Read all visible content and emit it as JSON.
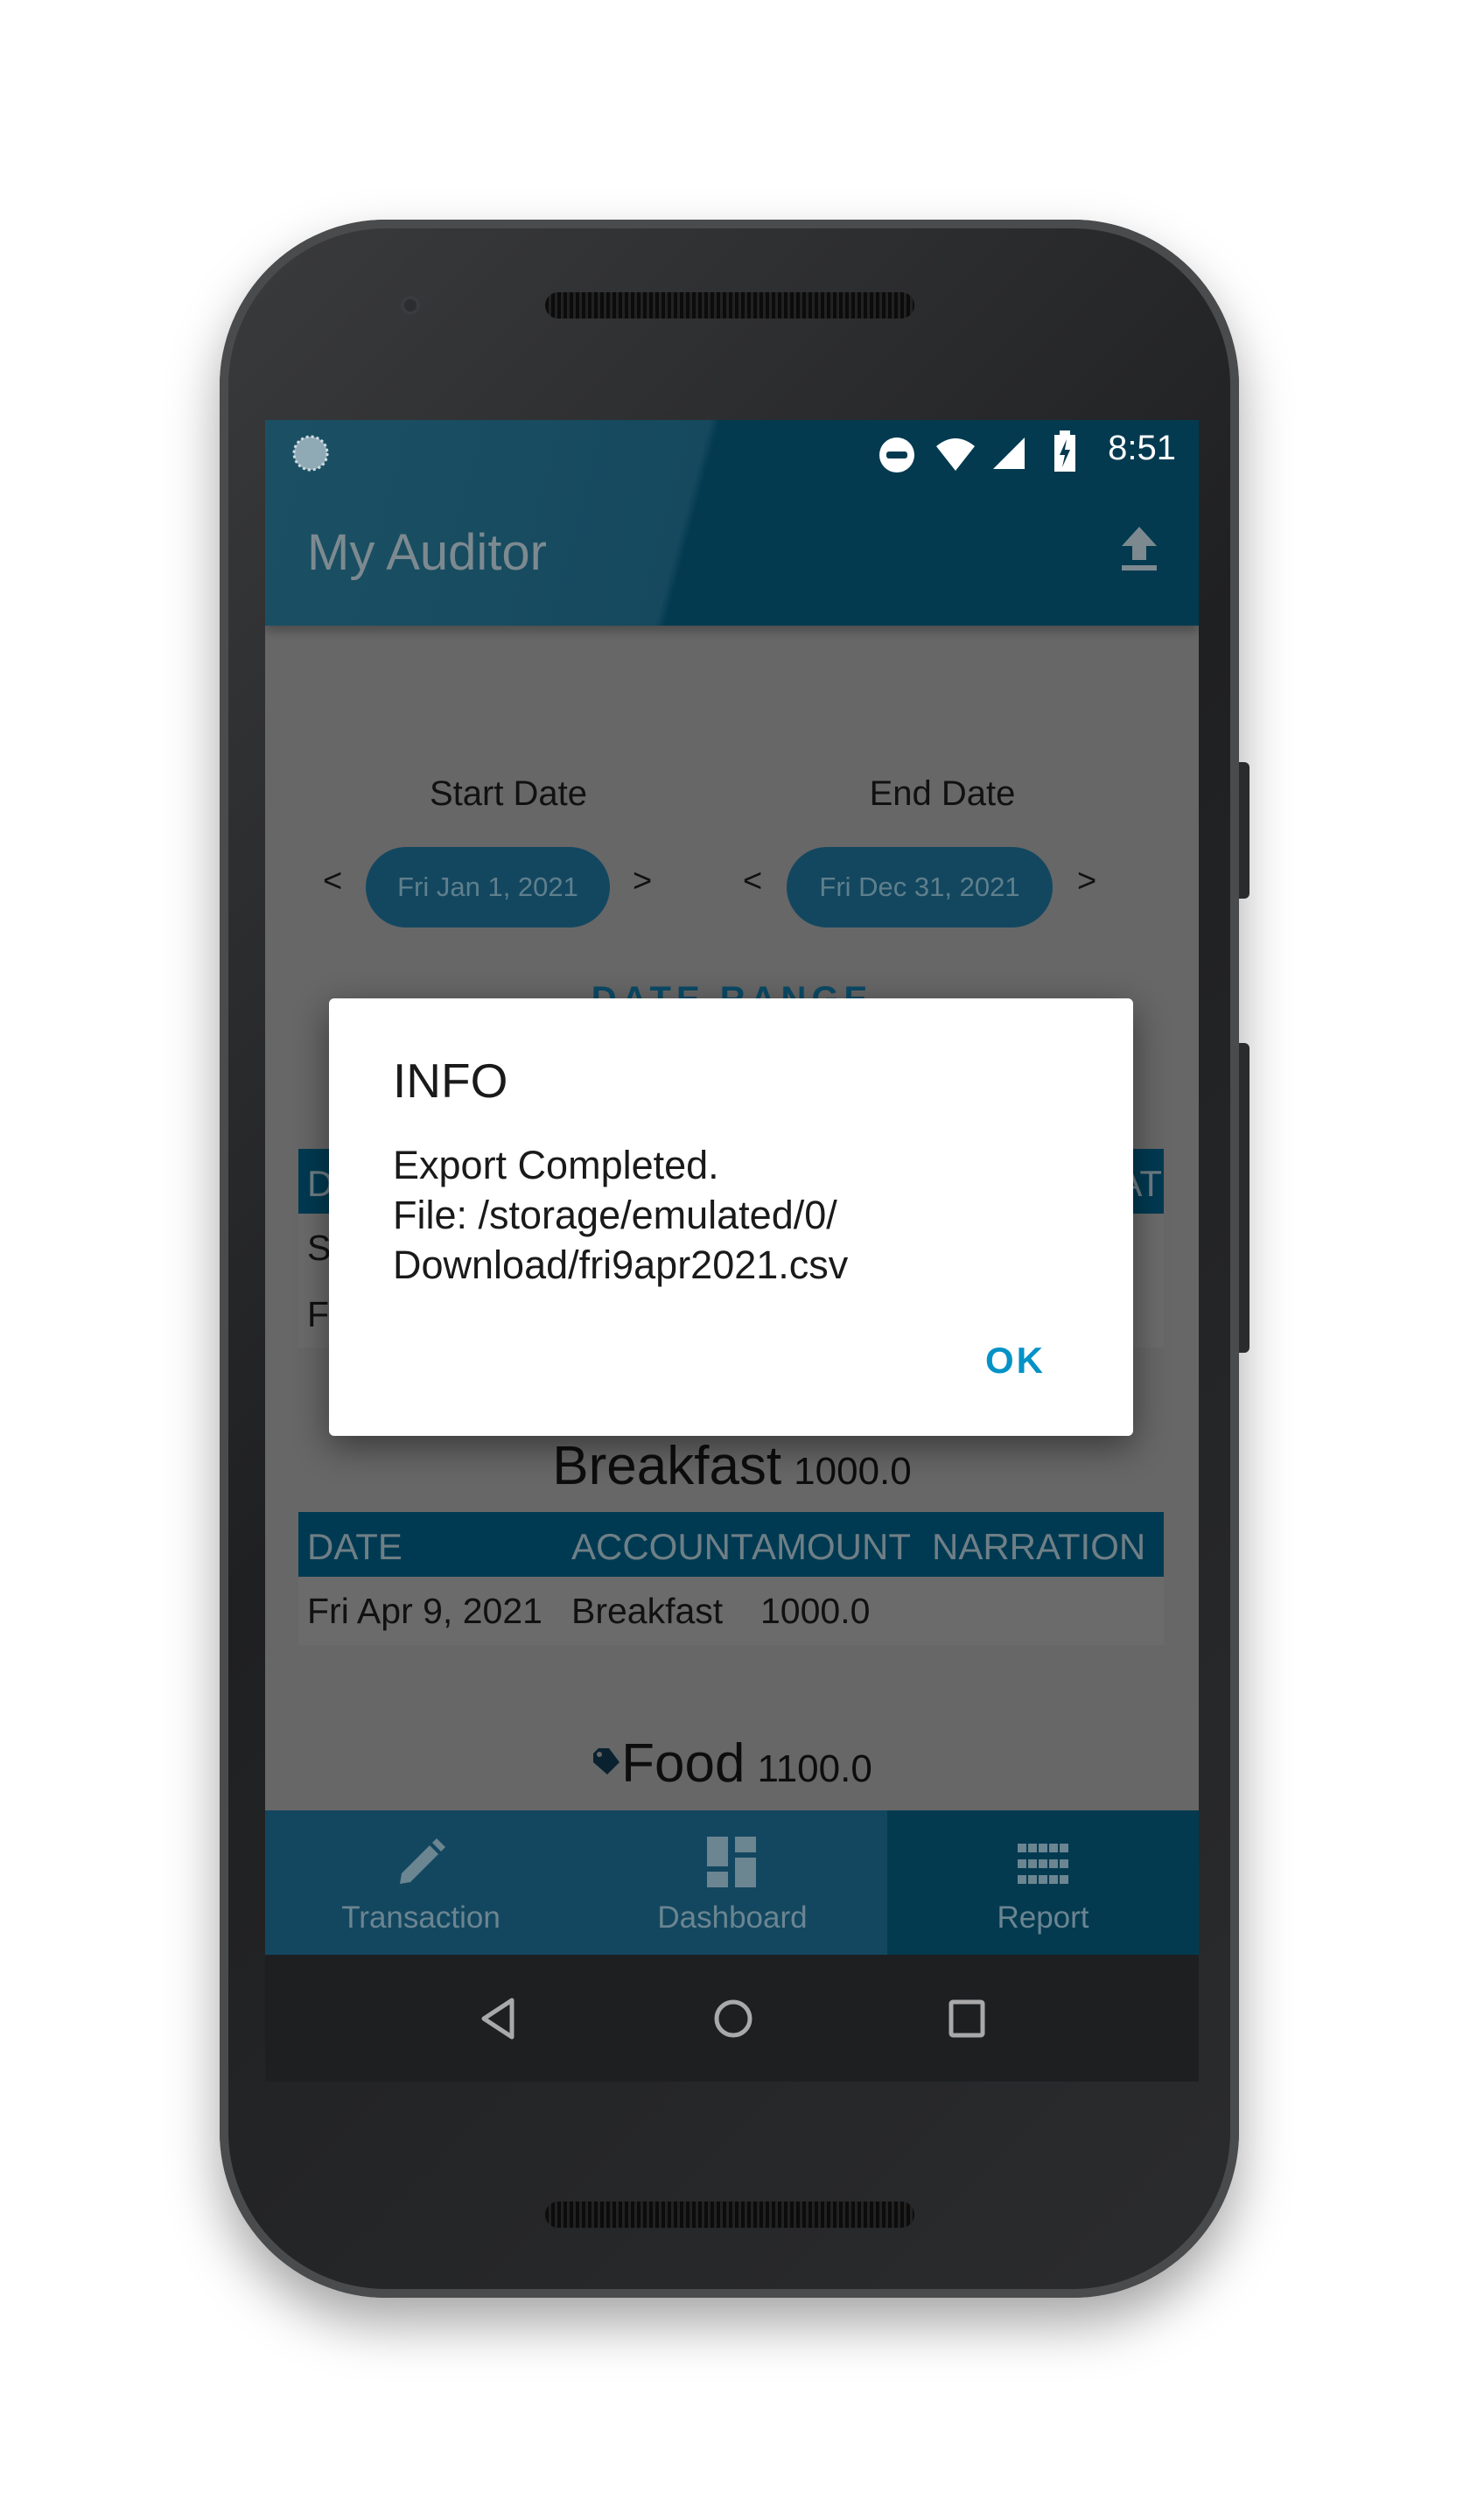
{
  "status_bar": {
    "time": "8:51",
    "icons": [
      "sync-icon",
      "do-not-disturb-icon",
      "wifi-icon",
      "signal-icon",
      "battery-charging-icon"
    ]
  },
  "app_bar": {
    "title": "My Auditor",
    "action_icon": "upload-icon"
  },
  "date_range": {
    "start_label": "Start Date",
    "start_value": "Fri Jan 1, 2021",
    "end_label": "End Date",
    "end_value": "Fri Dec 31, 2021",
    "prev": "<",
    "next": ">",
    "section_title": "DATE RANGE"
  },
  "background_table": {
    "header_first": "D",
    "header_last": "AT",
    "rows": [
      "S",
      "F"
    ]
  },
  "categories": [
    {
      "name": "Breakfast",
      "total": "1000.0",
      "columns": [
        "DATE",
        "ACCOUNT",
        "AMOUNT",
        "NARRATION"
      ],
      "rows": [
        {
          "date": "Fri Apr 9, 2021",
          "account": "Breakfast",
          "amount": "1000.0",
          "narration": ""
        }
      ]
    },
    {
      "name": "Food",
      "total": "1100.0",
      "icon": "tag-icon"
    }
  ],
  "dialog": {
    "title": "INFO",
    "line1": "Export Completed.",
    "line2": "File: /storage/emulated/0/",
    "line3": "Download/fri9apr2021.csv",
    "ok_label": "OK"
  },
  "bottom_nav": {
    "tabs": [
      {
        "label": "Transaction",
        "icon": "pencil-icon"
      },
      {
        "label": "Dashboard",
        "icon": "dashboard-icon"
      },
      {
        "label": "Report",
        "icon": "grid-icon",
        "active": true
      }
    ]
  },
  "colors": {
    "primary": "#033a50",
    "accent": "#0592c6",
    "scrim": "#676767"
  }
}
